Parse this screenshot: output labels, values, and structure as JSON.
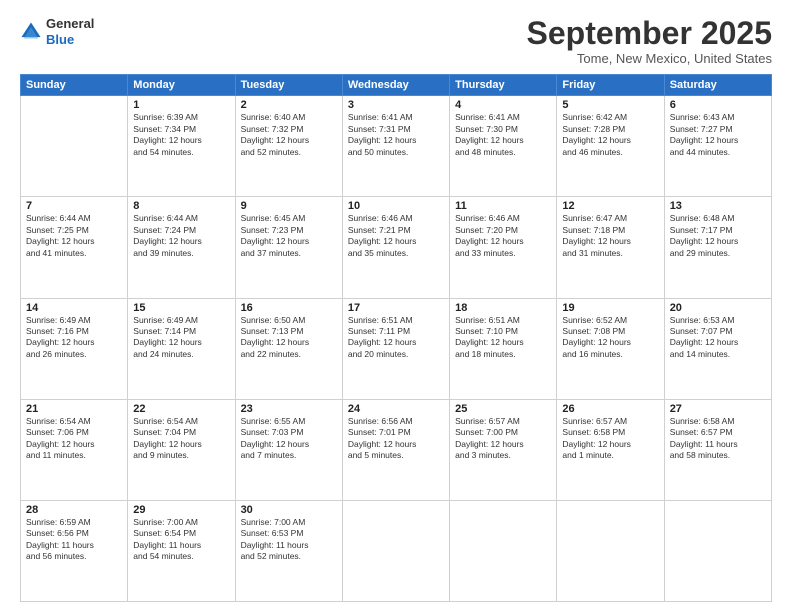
{
  "header": {
    "logo": {
      "general": "General",
      "blue": "Blue"
    },
    "title": "September 2025",
    "location": "Tome, New Mexico, United States"
  },
  "calendar": {
    "days_of_week": [
      "Sunday",
      "Monday",
      "Tuesday",
      "Wednesday",
      "Thursday",
      "Friday",
      "Saturday"
    ],
    "weeks": [
      [
        {
          "day": "",
          "info": ""
        },
        {
          "day": "1",
          "info": "Sunrise: 6:39 AM\nSunset: 7:34 PM\nDaylight: 12 hours\nand 54 minutes."
        },
        {
          "day": "2",
          "info": "Sunrise: 6:40 AM\nSunset: 7:32 PM\nDaylight: 12 hours\nand 52 minutes."
        },
        {
          "day": "3",
          "info": "Sunrise: 6:41 AM\nSunset: 7:31 PM\nDaylight: 12 hours\nand 50 minutes."
        },
        {
          "day": "4",
          "info": "Sunrise: 6:41 AM\nSunset: 7:30 PM\nDaylight: 12 hours\nand 48 minutes."
        },
        {
          "day": "5",
          "info": "Sunrise: 6:42 AM\nSunset: 7:28 PM\nDaylight: 12 hours\nand 46 minutes."
        },
        {
          "day": "6",
          "info": "Sunrise: 6:43 AM\nSunset: 7:27 PM\nDaylight: 12 hours\nand 44 minutes."
        }
      ],
      [
        {
          "day": "7",
          "info": "Sunrise: 6:44 AM\nSunset: 7:25 PM\nDaylight: 12 hours\nand 41 minutes."
        },
        {
          "day": "8",
          "info": "Sunrise: 6:44 AM\nSunset: 7:24 PM\nDaylight: 12 hours\nand 39 minutes."
        },
        {
          "day": "9",
          "info": "Sunrise: 6:45 AM\nSunset: 7:23 PM\nDaylight: 12 hours\nand 37 minutes."
        },
        {
          "day": "10",
          "info": "Sunrise: 6:46 AM\nSunset: 7:21 PM\nDaylight: 12 hours\nand 35 minutes."
        },
        {
          "day": "11",
          "info": "Sunrise: 6:46 AM\nSunset: 7:20 PM\nDaylight: 12 hours\nand 33 minutes."
        },
        {
          "day": "12",
          "info": "Sunrise: 6:47 AM\nSunset: 7:18 PM\nDaylight: 12 hours\nand 31 minutes."
        },
        {
          "day": "13",
          "info": "Sunrise: 6:48 AM\nSunset: 7:17 PM\nDaylight: 12 hours\nand 29 minutes."
        }
      ],
      [
        {
          "day": "14",
          "info": "Sunrise: 6:49 AM\nSunset: 7:16 PM\nDaylight: 12 hours\nand 26 minutes."
        },
        {
          "day": "15",
          "info": "Sunrise: 6:49 AM\nSunset: 7:14 PM\nDaylight: 12 hours\nand 24 minutes."
        },
        {
          "day": "16",
          "info": "Sunrise: 6:50 AM\nSunset: 7:13 PM\nDaylight: 12 hours\nand 22 minutes."
        },
        {
          "day": "17",
          "info": "Sunrise: 6:51 AM\nSunset: 7:11 PM\nDaylight: 12 hours\nand 20 minutes."
        },
        {
          "day": "18",
          "info": "Sunrise: 6:51 AM\nSunset: 7:10 PM\nDaylight: 12 hours\nand 18 minutes."
        },
        {
          "day": "19",
          "info": "Sunrise: 6:52 AM\nSunset: 7:08 PM\nDaylight: 12 hours\nand 16 minutes."
        },
        {
          "day": "20",
          "info": "Sunrise: 6:53 AM\nSunset: 7:07 PM\nDaylight: 12 hours\nand 14 minutes."
        }
      ],
      [
        {
          "day": "21",
          "info": "Sunrise: 6:54 AM\nSunset: 7:06 PM\nDaylight: 12 hours\nand 11 minutes."
        },
        {
          "day": "22",
          "info": "Sunrise: 6:54 AM\nSunset: 7:04 PM\nDaylight: 12 hours\nand 9 minutes."
        },
        {
          "day": "23",
          "info": "Sunrise: 6:55 AM\nSunset: 7:03 PM\nDaylight: 12 hours\nand 7 minutes."
        },
        {
          "day": "24",
          "info": "Sunrise: 6:56 AM\nSunset: 7:01 PM\nDaylight: 12 hours\nand 5 minutes."
        },
        {
          "day": "25",
          "info": "Sunrise: 6:57 AM\nSunset: 7:00 PM\nDaylight: 12 hours\nand 3 minutes."
        },
        {
          "day": "26",
          "info": "Sunrise: 6:57 AM\nSunset: 6:58 PM\nDaylight: 12 hours\nand 1 minute."
        },
        {
          "day": "27",
          "info": "Sunrise: 6:58 AM\nSunset: 6:57 PM\nDaylight: 11 hours\nand 58 minutes."
        }
      ],
      [
        {
          "day": "28",
          "info": "Sunrise: 6:59 AM\nSunset: 6:56 PM\nDaylight: 11 hours\nand 56 minutes."
        },
        {
          "day": "29",
          "info": "Sunrise: 7:00 AM\nSunset: 6:54 PM\nDaylight: 11 hours\nand 54 minutes."
        },
        {
          "day": "30",
          "info": "Sunrise: 7:00 AM\nSunset: 6:53 PM\nDaylight: 11 hours\nand 52 minutes."
        },
        {
          "day": "",
          "info": ""
        },
        {
          "day": "",
          "info": ""
        },
        {
          "day": "",
          "info": ""
        },
        {
          "day": "",
          "info": ""
        }
      ]
    ]
  }
}
